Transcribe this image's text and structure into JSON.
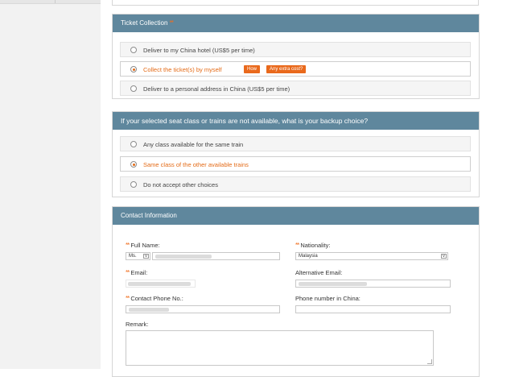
{
  "ticket_collection": {
    "title": "Ticket Collection",
    "required_mark": "**",
    "options": [
      {
        "label": "Deliver to my China hotel (US$5 per time)",
        "selected": false
      },
      {
        "label": "Collect the ticket(s) by myself",
        "selected": true,
        "badges": [
          "How",
          "Any extra cost?"
        ]
      },
      {
        "label": "Deliver to a personal address in China (US$5 per time)",
        "selected": false
      }
    ]
  },
  "backup_choice": {
    "title": "If your selected seat class or trains are not available, what is your backup choice?",
    "options": [
      {
        "label": "Any class available for the same train",
        "selected": false
      },
      {
        "label": "Same class of the other available trains",
        "selected": true
      },
      {
        "label": "Do not accept other choices",
        "selected": false
      }
    ]
  },
  "contact": {
    "title": "Contact Information",
    "required_mark": "**",
    "full_name_label": "Full Name:",
    "title_select_value": "Ms.",
    "nationality_label": "Nationality:",
    "nationality_value": "Malaysia",
    "email_label": "Email:",
    "alt_email_label": "Alternative Email:",
    "phone_label": "Contact Phone No.:",
    "china_phone_label": "Phone number in China:",
    "remark_label": "Remark:"
  },
  "colors": {
    "header": "#5f879d",
    "accent": "#e46b17",
    "badge": "#e9691c"
  }
}
